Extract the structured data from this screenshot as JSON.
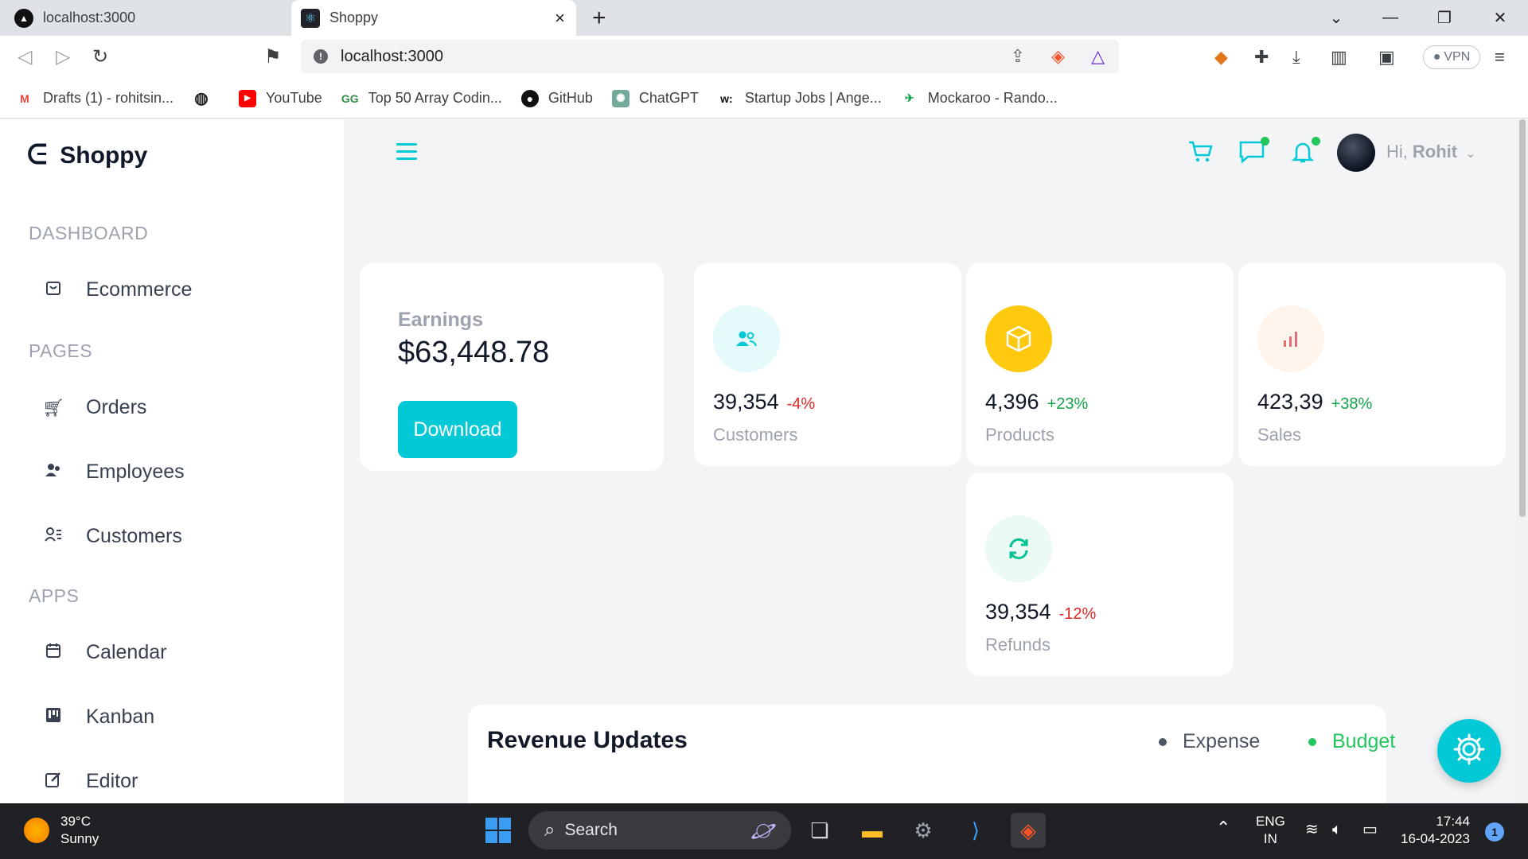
{
  "browser": {
    "tabs": [
      {
        "title": "localhost:3000",
        "active": false
      },
      {
        "title": "Shoppy",
        "active": true
      }
    ],
    "address": "localhost:3000",
    "vpn_label": "VPN",
    "bookmarks": [
      {
        "label": "Drafts (1) - rohitsin...",
        "icon": "gmail-icon"
      },
      {
        "label": "",
        "icon": "globe-icon"
      },
      {
        "label": "YouTube",
        "icon": "youtube-icon"
      },
      {
        "label": "Top 50 Array Codin...",
        "icon": "gfg-icon"
      },
      {
        "label": "GitHub",
        "icon": "github-icon"
      },
      {
        "label": "ChatGPT",
        "icon": "chatgpt-icon"
      },
      {
        "label": "Startup Jobs | Ange...",
        "icon": "wellfound-icon"
      },
      {
        "label": "Mockaroo - Rando...",
        "icon": "mockaroo-icon"
      }
    ]
  },
  "app": {
    "name": "Shoppy",
    "sidebar": {
      "sections": [
        {
          "title": "DASHBOARD",
          "items": [
            {
              "label": "Ecommerce",
              "icon": "shopping-bag-icon"
            }
          ]
        },
        {
          "title": "PAGES",
          "items": [
            {
              "label": "Orders",
              "icon": "cart-icon"
            },
            {
              "label": "Employees",
              "icon": "employees-icon"
            },
            {
              "label": "Customers",
              "icon": "customers-icon"
            }
          ]
        },
        {
          "title": "APPS",
          "items": [
            {
              "label": "Calendar",
              "icon": "calendar-icon"
            },
            {
              "label": "Kanban",
              "icon": "kanban-icon"
            },
            {
              "label": "Editor",
              "icon": "editor-icon"
            }
          ]
        }
      ]
    },
    "header": {
      "greeting": "Hi,",
      "username": "Rohit"
    },
    "earnings": {
      "title": "Earnings",
      "value": "$63,448.78",
      "button": "Download"
    },
    "stats": [
      {
        "value": "39,354",
        "change": "-4%",
        "label": "Customers",
        "icon": "customers-icon",
        "icon_color": "#03c9d7",
        "icon_bg": "#e5fafb",
        "change_color": "#dc2626"
      },
      {
        "value": "4,396",
        "change": "+23%",
        "label": "Products",
        "icon": "box-icon",
        "icon_color": "#ffffff",
        "icon_bg": "#fec90f",
        "change_color": "#16a34a"
      },
      {
        "value": "423,39",
        "change": "+38%",
        "label": "Sales",
        "icon": "bar-chart-icon",
        "icon_color": "#e46a76",
        "icon_bg": "#fff4ec",
        "change_color": "#16a34a"
      },
      {
        "value": "39,354",
        "change": "-12%",
        "label": "Refunds",
        "icon": "refresh-icon",
        "icon_color": "#00c292",
        "icon_bg": "#ebfaf2",
        "change_color": "#dc2626"
      }
    ],
    "revenue": {
      "title": "Revenue Updates",
      "legend": [
        {
          "label": "Expense",
          "color": "#4b5563"
        },
        {
          "label": "Budget",
          "color": "#22c55e"
        }
      ]
    },
    "accent": "#03c9d7"
  },
  "taskbar": {
    "weather_temp": "39°C",
    "weather_desc": "Sunny",
    "search": "Search",
    "lang_top": "ENG",
    "lang_bottom": "IN",
    "time": "17:44",
    "date": "16-04-2023",
    "notifications": "1"
  }
}
